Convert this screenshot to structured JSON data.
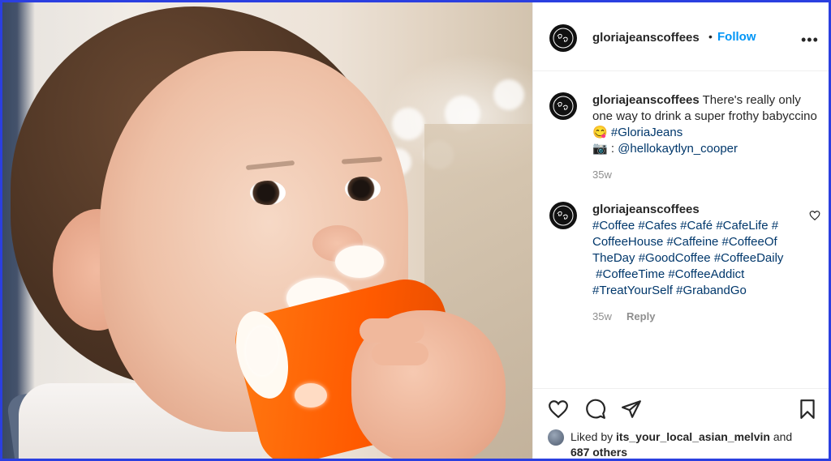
{
  "post": {
    "username": "gloriajeanscoffees",
    "separator": "•",
    "follow_label": "Follow",
    "more_label": "•••"
  },
  "caption": {
    "username": "gloriajeanscoffees",
    "text_1": "There's really only one way to drink a super frothy babyccino 😋",
    "hashtag": "#GloriaJeans",
    "credit_icon": "📷",
    "credit_text": ":",
    "mention": "@hellokaytlyn_cooper",
    "time": "35w"
  },
  "comment": {
    "username": "gloriajeanscoffees",
    "hashtags_line1": "#Coffee #Cafes #Café #CafeLife #",
    "hashtags_line2": "CoffeeHouse #Caffeine #CoffeeOf",
    "hashtags_line3": "TheDay #GoodCoffee #CoffeeDaily",
    "hashtags_line4": " #CoffeeTime #CoffeeAddict",
    "hashtags_line5": "#TreatYourSelf #GrabandGo",
    "time": "35w",
    "reply_label": "Reply"
  },
  "likes": {
    "prefix": "Liked by",
    "user": "its_your_local_asian_melvin",
    "joiner": "and",
    "others": "687 others"
  },
  "icons": {
    "like": "heart-icon",
    "comment": "comment-icon",
    "share": "share-icon",
    "save": "bookmark-icon",
    "more": "more-icon",
    "comment_like": "heart-icon"
  },
  "colors": {
    "frame": "#2b3fe0",
    "link": "#0095f6",
    "hashtag": "#00376b",
    "muted": "#8e8e8e"
  }
}
